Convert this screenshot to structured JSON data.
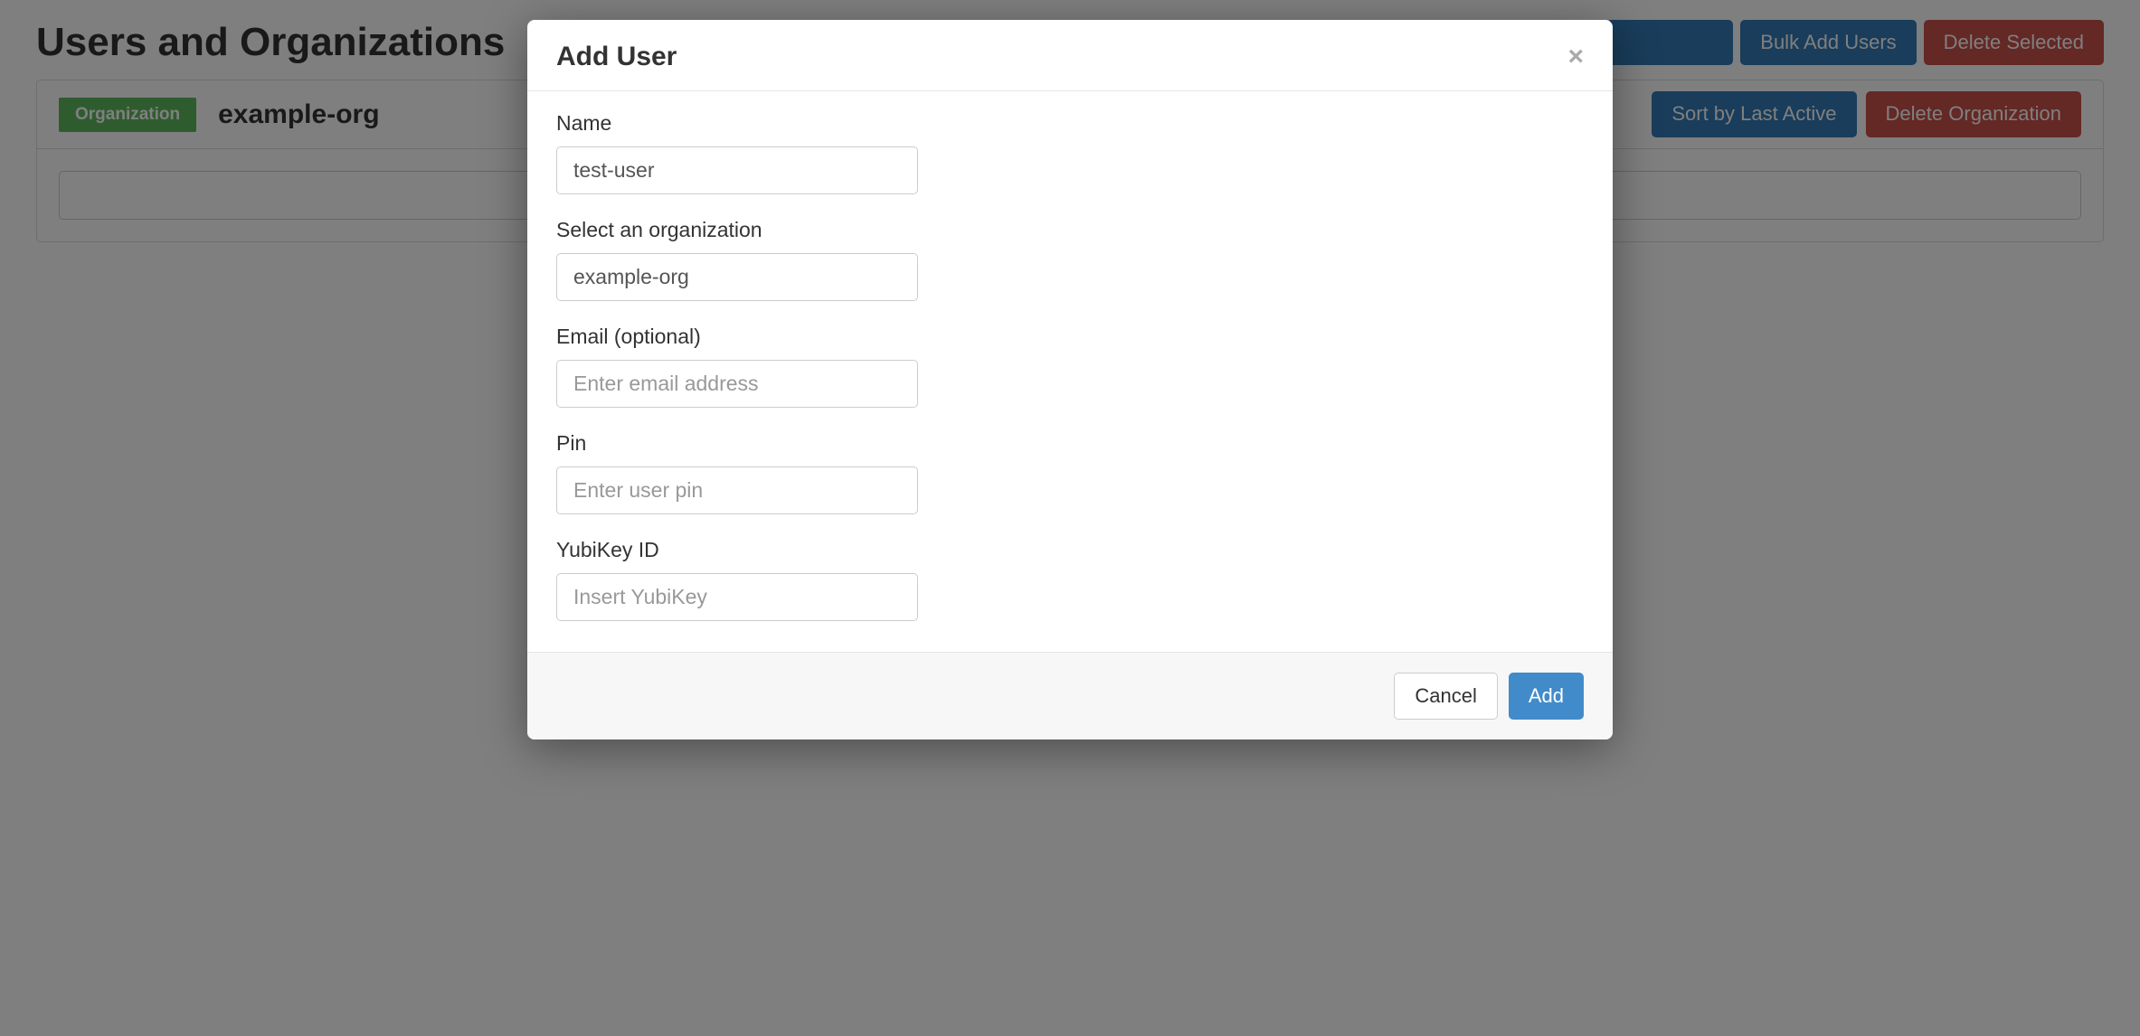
{
  "page": {
    "title": "Users and Organizations"
  },
  "header_buttons": {
    "bulk_add_users": "Bulk Add Users",
    "delete_selected": "Delete Selected"
  },
  "org_panel": {
    "badge": "Organization",
    "name": "example-org",
    "sort_button": "Sort by Last Active",
    "delete_button": "Delete Organization",
    "search_placeholder": ""
  },
  "modal": {
    "title": "Add User",
    "close_glyph": "×",
    "fields": {
      "name": {
        "label": "Name",
        "value": "test-user"
      },
      "organization": {
        "label": "Select an organization",
        "value": "example-org"
      },
      "email": {
        "label": "Email (optional)",
        "placeholder": "Enter email address",
        "value": ""
      },
      "pin": {
        "label": "Pin",
        "placeholder": "Enter user pin",
        "value": ""
      },
      "yubikey": {
        "label": "YubiKey ID",
        "placeholder": "Insert YubiKey",
        "value": ""
      }
    },
    "footer": {
      "cancel": "Cancel",
      "add": "Add"
    }
  }
}
